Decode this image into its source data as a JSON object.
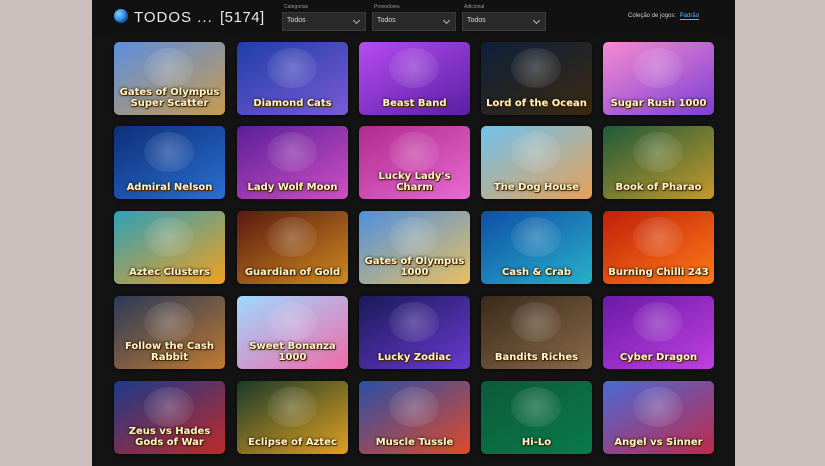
{
  "header": {
    "title": "TODOS ...",
    "count": "[5174]",
    "filters": [
      {
        "label": "Categorias",
        "value": "Todos"
      },
      {
        "label": "Provedores",
        "value": "Todos"
      },
      {
        "label": "Adicional",
        "value": "Todos"
      }
    ],
    "collection_label": "Coleção de jogos:",
    "collection_value": "Padrão"
  },
  "games": [
    {
      "name": "Gates of Olympus Super Scatter",
      "colors": [
        "#5b8fe0",
        "#c89a4e"
      ]
    },
    {
      "name": "Diamond Cats",
      "colors": [
        "#1f3fa8",
        "#7a5ad6"
      ]
    },
    {
      "name": "Beast Band",
      "colors": [
        "#b64cf0",
        "#5a1fa4"
      ]
    },
    {
      "name": "Lord of the Ocean",
      "colors": [
        "#0e1f3a",
        "#3a2a10"
      ]
    },
    {
      "name": "Sugar Rush 1000",
      "colors": [
        "#f58bd1",
        "#7d3fd6"
      ]
    },
    {
      "name": "Admiral Nelson",
      "colors": [
        "#0e2f7a",
        "#2a6fd1"
      ]
    },
    {
      "name": "Lady Wolf Moon",
      "colors": [
        "#5a1f9a",
        "#d04fc2"
      ]
    },
    {
      "name": "Lucky Lady's Charm",
      "colors": [
        "#b02b8f",
        "#e86ad0"
      ]
    },
    {
      "name": "The Dog House",
      "colors": [
        "#6fc3ef",
        "#e8a058"
      ]
    },
    {
      "name": "Book of Pharao",
      "colors": [
        "#1f5a3a",
        "#c49a2a"
      ]
    },
    {
      "name": "Aztec Clusters",
      "colors": [
        "#2ea0b8",
        "#f0a020"
      ]
    },
    {
      "name": "Guardian of Gold",
      "colors": [
        "#5a1a10",
        "#d08a20"
      ]
    },
    {
      "name": "Gates of Olympus 1000",
      "colors": [
        "#4f8fe0",
        "#e8c060"
      ]
    },
    {
      "name": "Cash & Crab",
      "colors": [
        "#0f4fa8",
        "#28b0c8"
      ]
    },
    {
      "name": "Burning Chilli 243",
      "colors": [
        "#c0200a",
        "#ff7a18"
      ]
    },
    {
      "name": "Follow the Cash Rabbit",
      "colors": [
        "#2a3a5a",
        "#c07a30"
      ]
    },
    {
      "name": "Sweet Bonanza 1000",
      "colors": [
        "#9fd8ff",
        "#f06aa8"
      ]
    },
    {
      "name": "Lucky Zodiac",
      "colors": [
        "#1a1a5a",
        "#6a3ad0"
      ]
    },
    {
      "name": "Bandits Riches",
      "colors": [
        "#3a2a1a",
        "#8a6a4a"
      ]
    },
    {
      "name": "Cyber Dragon",
      "colors": [
        "#6a1aa8",
        "#c040e0"
      ]
    },
    {
      "name": "Zeus vs Hades Gods of War",
      "colors": [
        "#1a3a8a",
        "#c02a2a"
      ]
    },
    {
      "name": "Eclipse of Aztec",
      "colors": [
        "#1a3a2a",
        "#e0a020"
      ]
    },
    {
      "name": "Muscle Tussle",
      "colors": [
        "#2a4fa8",
        "#e04a2a"
      ]
    },
    {
      "name": "Hi-Lo",
      "colors": [
        "#0d5a3a",
        "#0a7a4a"
      ]
    },
    {
      "name": "Angel vs Sinner",
      "colors": [
        "#4a6ad8",
        "#c02a4a"
      ]
    }
  ]
}
